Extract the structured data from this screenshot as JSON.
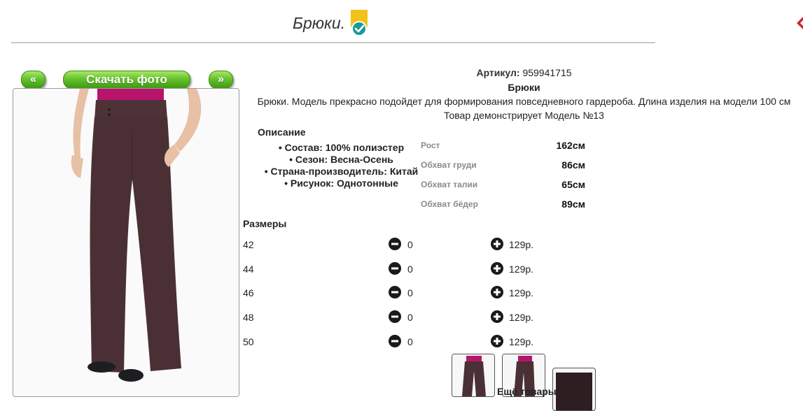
{
  "header": {
    "title": "Брюки."
  },
  "nav": {
    "prev_label": "«",
    "download_label": "Скачать фото",
    "next_label": "»"
  },
  "product": {
    "article_label": "Артикул:",
    "article_value": "959941715",
    "name": "Брюки",
    "description": "Брюки. Модель прекрасно подойдет для формирования повседневного гардероба. Длина изделия на модели 100 см",
    "model_note": "Товар демонстрирует Модель №13"
  },
  "description": {
    "heading": "Описание",
    "items": [
      "Состав: 100% полиэстер",
      "Сезон: Весна-Осень",
      "Страна-производитель: Китай",
      "Рисунок: Однотонные"
    ]
  },
  "measurements": [
    {
      "label": "Рост",
      "value": "162см"
    },
    {
      "label": "Обхват груди",
      "value": "86см"
    },
    {
      "label": "Обхват талии",
      "value": "65см"
    },
    {
      "label": "Обхват бёдер",
      "value": "89см"
    }
  ],
  "sizes": {
    "heading": "Размеры",
    "rows": [
      {
        "size": "42",
        "qty": "0",
        "price": "129р."
      },
      {
        "size": "44",
        "qty": "0",
        "price": "129р."
      },
      {
        "size": "46",
        "qty": "0",
        "price": "129р."
      },
      {
        "size": "48",
        "qty": "0",
        "price": "129р."
      },
      {
        "size": "50",
        "qty": "0",
        "price": "129р."
      }
    ]
  },
  "more_label": "Ещё товары:",
  "colors": {
    "button_green": "#5fbf24",
    "pants": "#4a3035",
    "top": "#b8146b",
    "badge_yellow": "#f2c21a",
    "badge_teal": "#1a9a9a"
  }
}
